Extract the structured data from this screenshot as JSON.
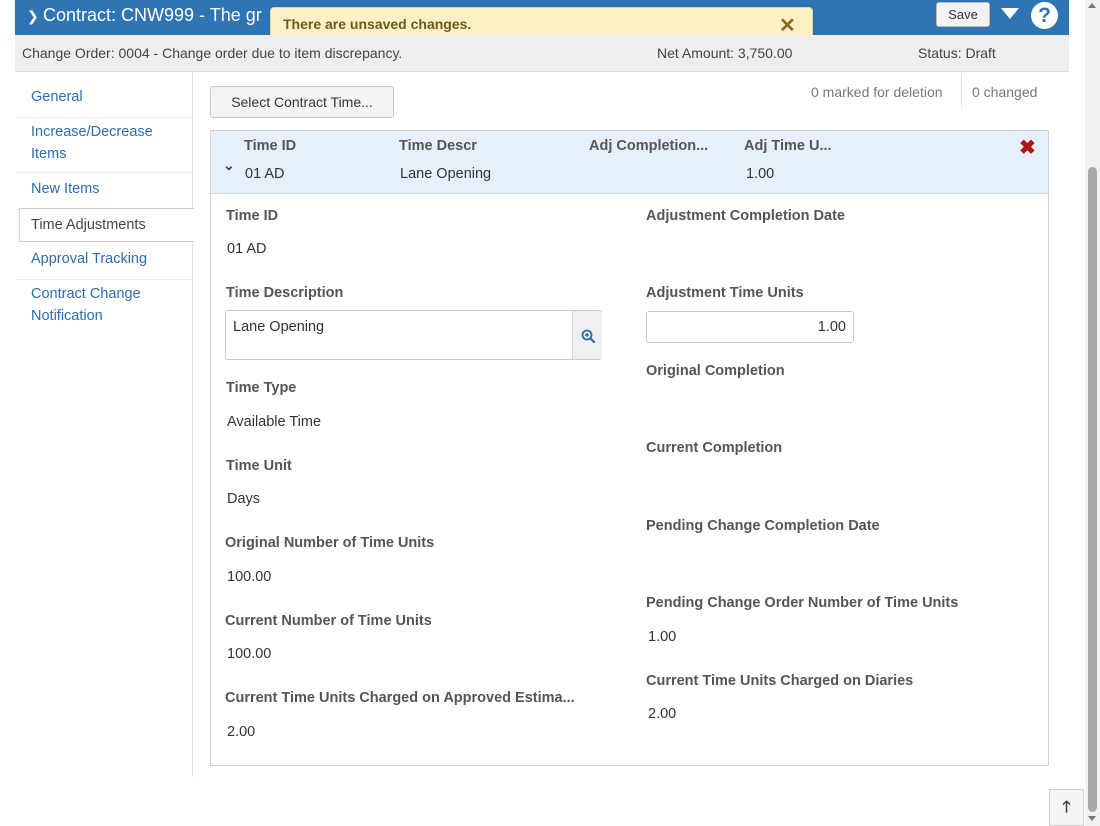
{
  "header": {
    "title": "Contract: CNW999 - The gr",
    "save_label": "Save",
    "help_label": "?"
  },
  "toast": {
    "message": "There are unsaved changes.",
    "close_glyph": "✕"
  },
  "subheader": {
    "change_order": "Change Order: 0004 - Change order due to item discrepancy.",
    "net_amount": "Net Amount: 3,750.00",
    "status": "Status: Draft"
  },
  "sidebar": {
    "items": [
      {
        "label": "General"
      },
      {
        "label": "Increase/Decrease Items"
      },
      {
        "label": "New Items"
      },
      {
        "label": "Time Adjustments"
      },
      {
        "label": "Approval Tracking"
      },
      {
        "label": "Contract Change Notification"
      }
    ]
  },
  "toolbar": {
    "select_button": "Select Contract Time...",
    "marked_for_deletion": "0 marked for deletion",
    "changed": "0 changed"
  },
  "row": {
    "headers": [
      "Time ID",
      "Time Descr",
      "Adj Completion...",
      "Adj Time U..."
    ],
    "values": [
      "01 AD",
      "Lane Opening",
      "",
      "1.00"
    ]
  },
  "detail": {
    "time_id_label": "Time ID",
    "time_id_value": "01 AD",
    "time_desc_label": "Time Description",
    "time_desc_value": "Lane Opening",
    "time_type_label": "Time Type",
    "time_type_value": "Available Time",
    "time_unit_label": "Time Unit",
    "time_unit_value": "Days",
    "orig_units_label": "Original Number of Time Units",
    "orig_units_value": "100.00",
    "curr_units_label": "Current Number of Time Units",
    "curr_units_value": "100.00",
    "charged_est_label": "Current Time Units Charged on Approved Estima...",
    "charged_est_value": "2.00",
    "adj_completion_label": "Adjustment Completion Date",
    "adj_units_label": "Adjustment Time Units",
    "adj_units_value": "1.00",
    "orig_completion_label": "Original Completion",
    "curr_completion_label": "Current Completion",
    "pending_completion_label": "Pending Change Completion Date",
    "pending_units_label": "Pending Change Order Number of Time Units",
    "pending_units_value": "1.00",
    "charged_diaries_label": "Current Time Units Charged on Diaries",
    "charged_diaries_value": "2.00"
  },
  "colors": {
    "header_bg": "#2f74b3",
    "link": "#2a6db1",
    "toast_bg": "#fdf0c4",
    "row_head_bg": "#e6f0fa",
    "delete": "#b01818"
  },
  "icons": {
    "chevron": "chevron-down-icon",
    "menu": "caret-down-icon",
    "help": "help-icon",
    "close": "close-icon",
    "delete": "delete-x-icon",
    "lookup": "zoom-in-icon",
    "back_to_top": "arrow-up-icon"
  }
}
